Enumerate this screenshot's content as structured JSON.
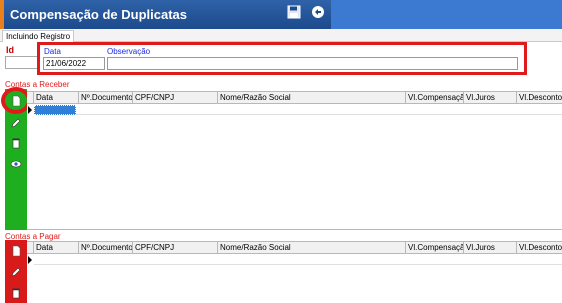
{
  "titlebar": {
    "title": "Compensação de Duplicatas",
    "accent_color": "#e8801e",
    "save_icon": "floppy-disk-icon",
    "back_icon": "back-arrow-icon"
  },
  "tabs": [
    {
      "label": "Incluindo Registro",
      "active": true
    }
  ],
  "form": {
    "id_label": "Id",
    "id_value": "",
    "data_label": "Data",
    "data_value": "21/06/2022",
    "obs_label": "Observação",
    "obs_value": ""
  },
  "receber": {
    "label": "Contas a Receber",
    "color": "#1fae1f",
    "tools": [
      "new-document-icon",
      "edit-pencil-icon",
      "delete-trash-icon",
      "view-eye-icon"
    ],
    "columns": [
      "Data",
      "Nº.Documento",
      "CPF/CNPJ",
      "Nome/Razão Social",
      "Vl.Compensação",
      "Vl.Juros",
      "Vl.Desconto"
    ]
  },
  "pagar": {
    "label": "Contas a Pagar",
    "color": "#d91a1a",
    "tools": [
      "new-document-icon",
      "edit-pencil-icon",
      "delete-trash-icon"
    ],
    "columns": [
      "Data",
      "Nº.Documento",
      "CPF/CNPJ",
      "Nome/Razão Social",
      "Vl.Compensação",
      "Vl.Juros",
      "Vl.Desconto"
    ]
  }
}
